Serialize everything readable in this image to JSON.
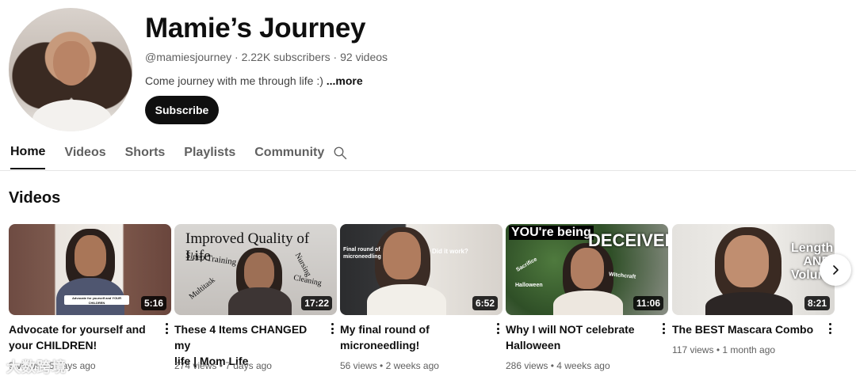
{
  "channel": {
    "name": "Mamie’s Journey",
    "handle": "@mamiesjourney",
    "subscribers": "2.22K subscribers",
    "videos_count": "92 videos",
    "separator": " · ",
    "description": "Come journey with me through life :)",
    "more_label": "...more",
    "subscribe_label": "Subscribe"
  },
  "tabs": [
    {
      "label": "Home",
      "active": true
    },
    {
      "label": "Videos",
      "active": false
    },
    {
      "label": "Shorts",
      "active": false
    },
    {
      "label": "Playlists",
      "active": false
    },
    {
      "label": "Community",
      "active": false
    }
  ],
  "section_title": "Videos",
  "videos": [
    {
      "title_line1": "Advocate for yourself and",
      "title_line2": "your CHILDREN!",
      "views": "9 views",
      "age": "5 days ago",
      "duration": "5:16",
      "thumb_text": "Advocate for yourself and YOUR CHILDREN"
    },
    {
      "title_line1": "These 4 Items CHANGED my",
      "title_line2": "life | Mom Life",
      "views": "274 views",
      "age": "7 days ago",
      "duration": "17:22",
      "thumb_text": "Improved Quality of Life",
      "thumb_words": [
        "Sleep Training",
        "Nursing",
        "Multitask",
        "Cleaning"
      ]
    },
    {
      "title_line1": "My final round of",
      "title_line2": "microneedling!",
      "views": "56 views",
      "age": "2 weeks ago",
      "duration": "6:52",
      "thumb_text": "Final round of microneedling",
      "thumb_text2": "Did it work?"
    },
    {
      "title_line1": "Why I will NOT celebrate",
      "title_line2": "Halloween",
      "views": "286 views",
      "age": "4 weeks ago",
      "duration": "11:06",
      "thumb_text": "YOU're being",
      "thumb_text2": "DECEIVED",
      "thumb_words": [
        "Sacrifice",
        "Witchcraft",
        "Halloween"
      ]
    },
    {
      "title_line1": "The BEST Mascara Combo",
      "title_line2": "",
      "views": "117 views",
      "age": "1 month ago",
      "duration": "8:21",
      "thumb_text": "Length AND Volume"
    }
  ],
  "meta_separator": " • ",
  "watermark": "大数跨境",
  "icons": {
    "search": "search-icon",
    "next": "chevron-right-icon",
    "more": "more-vert-icon"
  }
}
